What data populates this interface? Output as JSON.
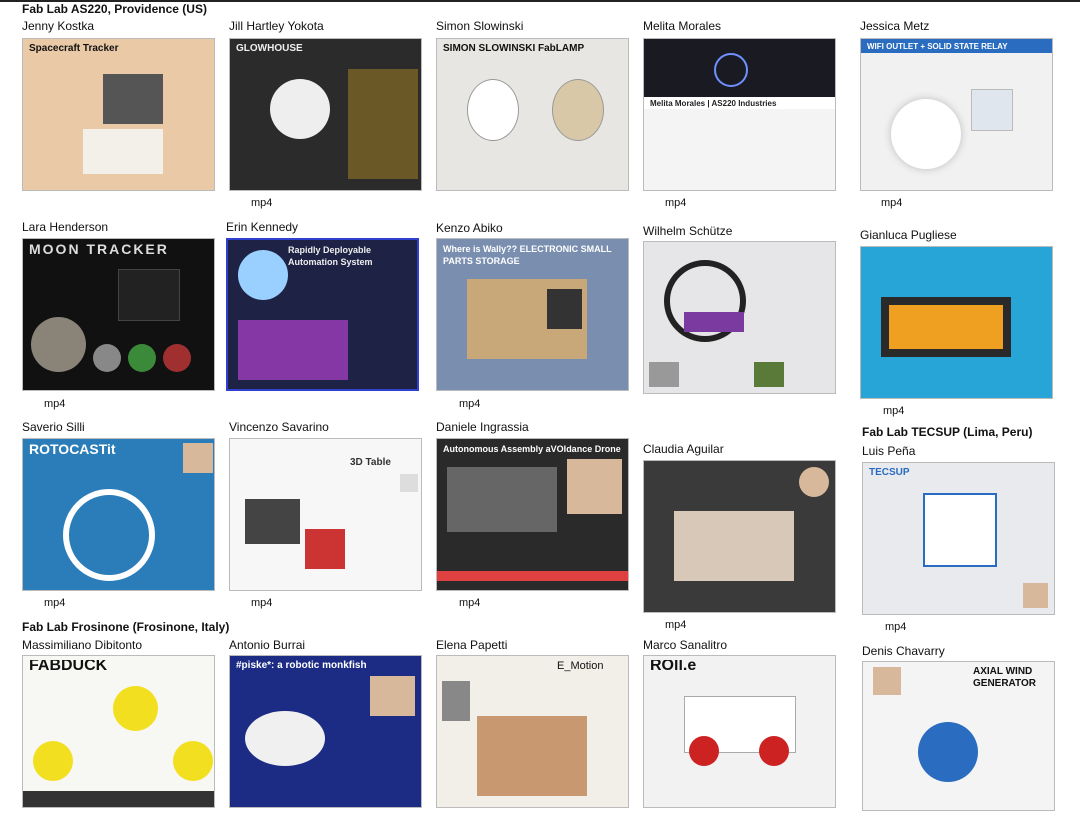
{
  "labs": {
    "ri": "Fab Lab AS220, Providence (US)",
    "tecsup": "Fab Lab TECSUP (Lima, Peru)",
    "frosinone": "Fab Lab Frosinone (Frosinone, Italy)"
  },
  "video_label": "mp4",
  "students": [
    {
      "name": "Jenny Kostka",
      "poster_title": "Spacecraft Tracker",
      "accent": "#c8744a",
      "bg": "#e9c9a6"
    },
    {
      "name": "Jill Hartley Yokota",
      "poster_title": "GLOWHOUSE",
      "accent": "#e0b020",
      "bg": "#2b2b2b"
    },
    {
      "name": "Simon Slowinski",
      "poster_title": "SIMON SLOWINSKI FabLAMP",
      "accent": "#222222",
      "bg": "#e8e6e2"
    },
    {
      "name": "Melita Morales",
      "poster_title": "Melita Morales | AS220 Industries",
      "accent": "#5a6a9a",
      "bg": "#2c2c34"
    },
    {
      "name": "Jessica Metz",
      "poster_title": "WIFI OUTLET + SOLID STATE RELAY",
      "accent": "#2a6cc0",
      "bg": "#f1f1f1"
    },
    {
      "name": "Lara Henderson",
      "poster_title": "MOON TRACKER",
      "accent": "#d8d8d8",
      "bg": "#111111"
    },
    {
      "name": "Erin Kennedy",
      "poster_title": "Rapidly Deployable Automation System",
      "accent": "#b040d0",
      "bg": "#1e2244"
    },
    {
      "name": "Kenzo Abiko",
      "poster_title": "Where is Wally?? ELECTRONIC SMALL PARTS STORAGE",
      "accent": "#ffffff",
      "bg": "#7a8fb0"
    },
    {
      "name": "Wilhelm Schütze",
      "poster_title": "",
      "accent": "#7a3aa0",
      "bg": "#e6e6e8"
    },
    {
      "name": "Gianluca Pugliese",
      "poster_title": "",
      "accent": "#f0a020",
      "bg": "#27a5d6"
    },
    {
      "name": "Saverio Silli",
      "poster_title": "ROTOCASTit",
      "accent": "#ffffff",
      "bg": "#2a7db8"
    },
    {
      "name": "Vincenzo Savarino",
      "poster_title": "3D Table",
      "accent": "#cc3333",
      "bg": "#f7f7f7"
    },
    {
      "name": "Daniele Ingrassia",
      "poster_title": "Autonomous Assembly aVOIdance Drone",
      "accent": "#e04040",
      "bg": "#2a2a2a"
    },
    {
      "name": "Claudia Aguilar",
      "poster_title": "",
      "accent": "#d8c8b8",
      "bg": "#3a3a3a"
    },
    {
      "name": "Luis Peña",
      "poster_title": "TECSUP",
      "accent": "#2a6cc0",
      "bg": "#e8eaee"
    },
    {
      "name": "Massimiliano Dibitonto",
      "poster_title": "FABDUCK",
      "accent": "#f2e020",
      "bg": "#f7f7f4"
    },
    {
      "name": "Antonio Burrai",
      "poster_title": "#piske*: a robotic monkfish",
      "accent": "#ff6666",
      "bg": "#1c2c84"
    },
    {
      "name": "Elena Papetti",
      "poster_title": "E_Motion",
      "accent": "#333333",
      "bg": "#f2efe8"
    },
    {
      "name": "Marco Sanalitro",
      "poster_title": "ROll.e",
      "accent": "#cc2222",
      "bg": "#f2f2f2"
    },
    {
      "name": "Denis Chavarry",
      "poster_title": "AXIAL WIND GENERATOR",
      "accent": "#2a6cc0",
      "bg": "#f4f4f4"
    }
  ]
}
